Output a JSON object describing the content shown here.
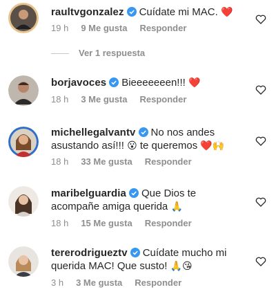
{
  "comments": [
    {
      "username": "raultvgonzalez",
      "text": "Cuídate mi MAC.",
      "emoji": "❤️",
      "time": "19 h",
      "likes": "9 Me gusta",
      "reply": "Responder"
    },
    {
      "username": "borjavoces",
      "text": "Bieeeeeeen!!!",
      "emoji": "❤️",
      "time": "18 h",
      "likes": "3 Me gusta",
      "reply": "Responder"
    },
    {
      "username": "michellegalvantv",
      "text_line1": "No nos andes",
      "text_line2": "asustando así!!!",
      "emoji1": "😮",
      "text_line2b": "te queremos",
      "emoji2": "❤️🙌",
      "time": "18 h",
      "likes": "33 Me gusta",
      "reply": "Responder"
    },
    {
      "username": "maribelguardia",
      "text_line1": "Que Dios te",
      "text_line2": "acompañe amiga querida",
      "emoji": "🙏",
      "time": "18 h",
      "likes": "15 Me gusta",
      "reply": "Responder"
    },
    {
      "username": "tererodrigueztv",
      "text_line1": "Cuídate mucho mi",
      "text_line2": "querida MAC!  Que susto!",
      "emoji": "🙏😘",
      "time": "3 h",
      "likes": "3 Me gusta",
      "reply": "Responder"
    }
  ],
  "view_replies": "Ver 1 respuesta",
  "colors": {
    "text": "#262626",
    "meta": "#8e8e8e",
    "verified": "#3897f0",
    "heart_red": "#ed4956"
  }
}
